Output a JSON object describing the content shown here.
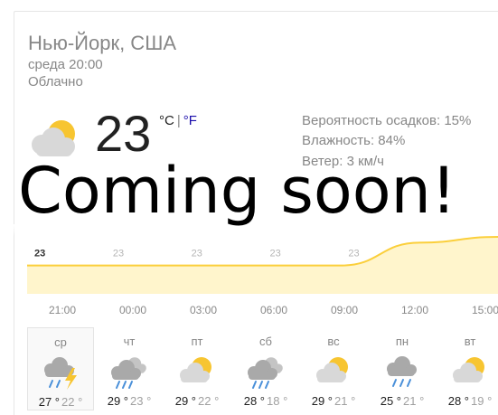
{
  "location": "Нью-Йорк, США",
  "time": "среда 20:00",
  "condition": "Облачно",
  "current": {
    "temp": "23",
    "unit_c": "°C",
    "unit_sep": "|",
    "unit_f": "°F",
    "icon": "partly-cloudy-icon"
  },
  "details": {
    "precip": "Вероятность осадков: 15%",
    "humidity": "Влажность: 84%",
    "wind": "Ветер: 3 км/ч"
  },
  "overlay_text": "Coming soon!",
  "chart_data": {
    "type": "area",
    "x": [
      "21:00",
      "00:00",
      "03:00",
      "06:00",
      "09:00",
      "12:00",
      "15:00"
    ],
    "visible_labels": [
      "23",
      "23",
      "23",
      "23",
      "23"
    ],
    "series": [
      {
        "values": [
          23,
          23,
          23,
          23,
          23,
          27,
          28
        ]
      }
    ],
    "fill_color": "#fff5cc",
    "line_color": "#fbcf3b"
  },
  "hours": [
    "21:00",
    "00:00",
    "03:00",
    "06:00",
    "09:00",
    "12:00",
    "15:00"
  ],
  "days": [
    {
      "name": "ср",
      "icon": "thunderstorm-icon",
      "hi": "27 °",
      "lo": "22 °",
      "selected": true
    },
    {
      "name": "чт",
      "icon": "rain-cloud-icon",
      "hi": "29 °",
      "lo": "23 °"
    },
    {
      "name": "пт",
      "icon": "partly-cloudy-icon",
      "hi": "29 °",
      "lo": "22 °"
    },
    {
      "name": "сб",
      "icon": "rain-cloud-icon",
      "hi": "28 °",
      "lo": "18 °"
    },
    {
      "name": "вс",
      "icon": "partly-cloudy-icon",
      "hi": "29 °",
      "lo": "21 °"
    },
    {
      "name": "пн",
      "icon": "rain-icon",
      "hi": "25 °",
      "lo": "21 °"
    },
    {
      "name": "вт",
      "icon": "partly-cloudy-icon",
      "hi": "28 °",
      "lo": "19 °"
    }
  ]
}
